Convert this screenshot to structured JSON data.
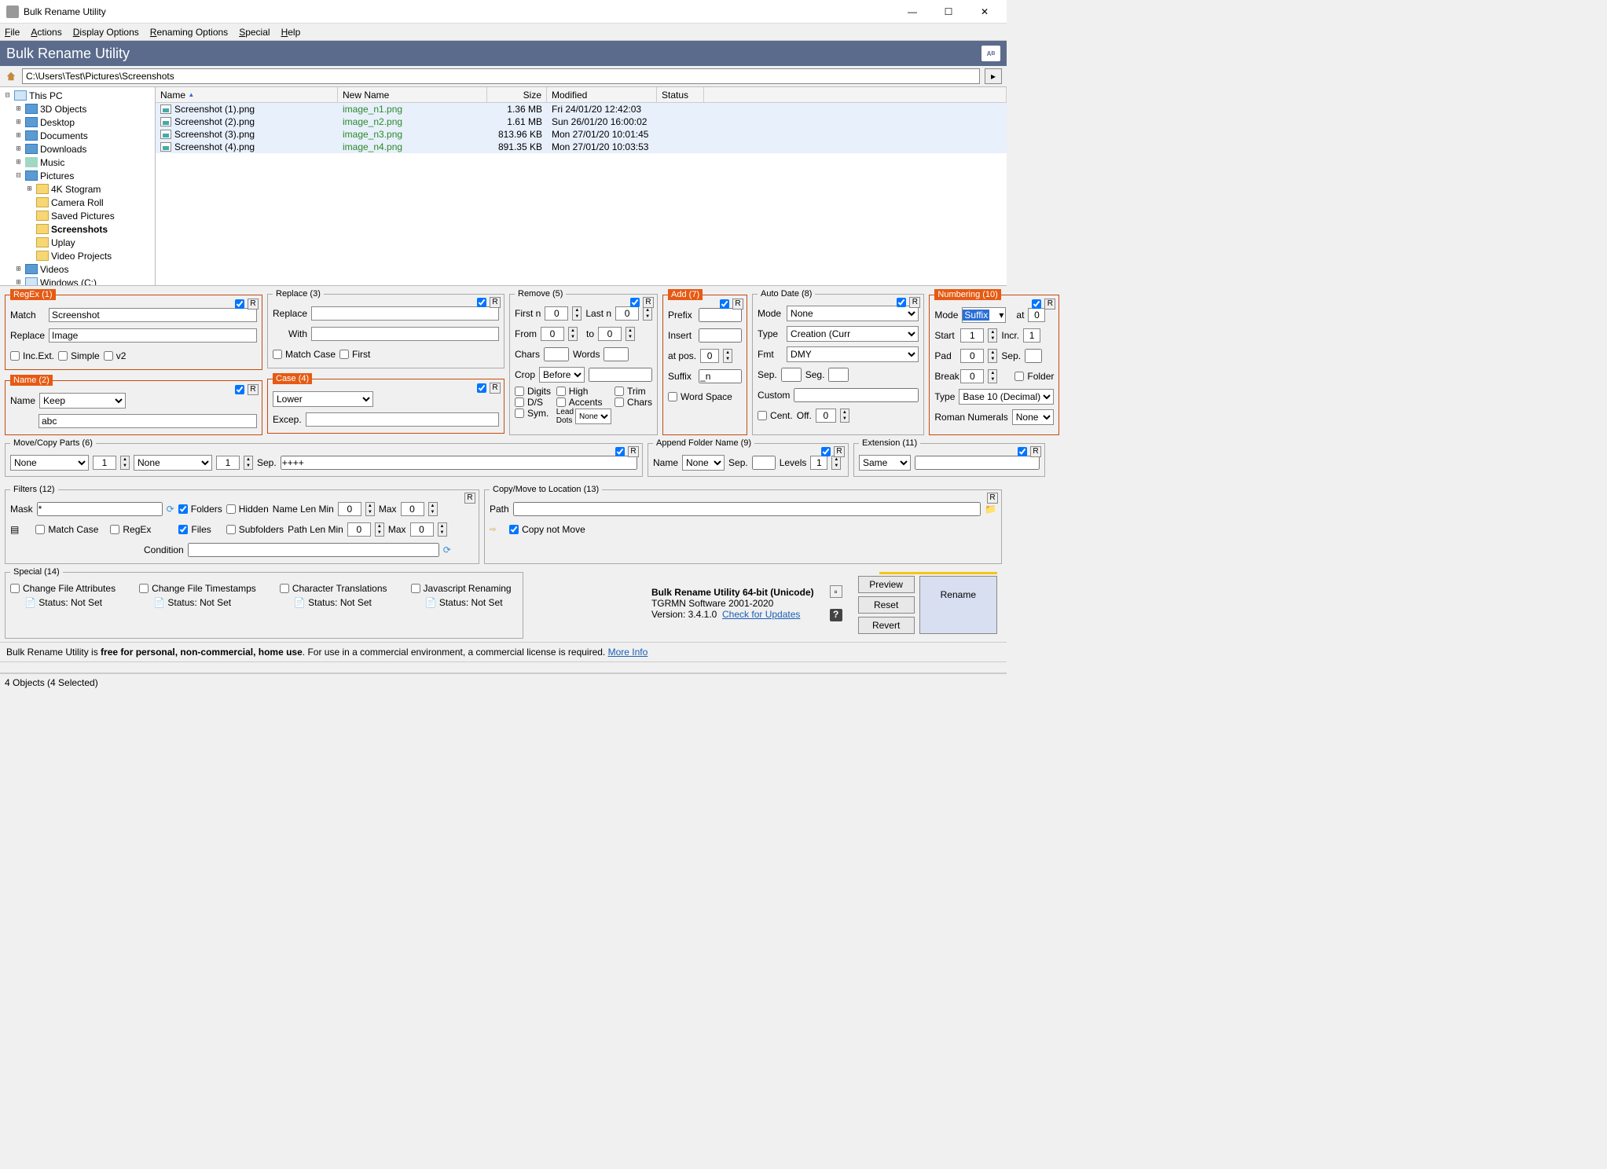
{
  "window": {
    "title": "Bulk Rename Utility"
  },
  "menu": [
    "File",
    "Actions",
    "Display Options",
    "Renaming Options",
    "Special",
    "Help"
  ],
  "banner": "Bulk Rename Utility",
  "path": "C:\\Users\\Test\\Pictures\\Screenshots",
  "tree": [
    {
      "indent": 0,
      "exp": "⊟",
      "icon": "pc",
      "label": "This PC"
    },
    {
      "indent": 1,
      "exp": "⊞",
      "icon": "blue",
      "label": "3D Objects"
    },
    {
      "indent": 1,
      "exp": "⊞",
      "icon": "blue",
      "label": "Desktop"
    },
    {
      "indent": 1,
      "exp": "⊞",
      "icon": "blue",
      "label": "Documents"
    },
    {
      "indent": 1,
      "exp": "⊞",
      "icon": "blue",
      "label": "Downloads"
    },
    {
      "indent": 1,
      "exp": "⊞",
      "icon": "music",
      "label": "Music"
    },
    {
      "indent": 1,
      "exp": "⊟",
      "icon": "blue",
      "label": "Pictures"
    },
    {
      "indent": 2,
      "exp": "⊞",
      "icon": "folder",
      "label": "4K Stogram"
    },
    {
      "indent": 2,
      "exp": "",
      "icon": "folder",
      "label": "Camera Roll"
    },
    {
      "indent": 2,
      "exp": "",
      "icon": "folder",
      "label": "Saved Pictures"
    },
    {
      "indent": 2,
      "exp": "",
      "icon": "folder",
      "label": "Screenshots",
      "bold": true
    },
    {
      "indent": 2,
      "exp": "",
      "icon": "folder",
      "label": "Uplay"
    },
    {
      "indent": 2,
      "exp": "",
      "icon": "folder",
      "label": "Video Projects"
    },
    {
      "indent": 1,
      "exp": "⊞",
      "icon": "blue",
      "label": "Videos"
    },
    {
      "indent": 1,
      "exp": "⊞",
      "icon": "drive",
      "label": "Windows (C:)"
    }
  ],
  "list": {
    "headers": {
      "name": "Name",
      "newname": "New Name",
      "size": "Size",
      "mod": "Modified",
      "status": "Status"
    },
    "rows": [
      {
        "name": "Screenshot (1).png",
        "newname": "image_n1.png",
        "size": "1.36 MB",
        "mod": "Fri 24/01/20 12:42:03"
      },
      {
        "name": "Screenshot (2).png",
        "newname": "image_n2.png",
        "size": "1.61 MB",
        "mod": "Sun 26/01/20 16:00:02"
      },
      {
        "name": "Screenshot (3).png",
        "newname": "image_n3.png",
        "size": "813.96 KB",
        "mod": "Mon 27/01/20 10:01:45"
      },
      {
        "name": "Screenshot (4).png",
        "newname": "image_n4.png",
        "size": "891.35 KB",
        "mod": "Mon 27/01/20 10:03:53"
      }
    ]
  },
  "regex": {
    "title": "RegEx (1)",
    "match_lbl": "Match",
    "match": "Screenshot",
    "replace_lbl": "Replace",
    "replace": "Image",
    "incext": "Inc.Ext.",
    "simple": "Simple",
    "v2": "v2"
  },
  "name": {
    "title": "Name (2)",
    "name_lbl": "Name",
    "mode": "Keep",
    "value": "abc"
  },
  "replace": {
    "title": "Replace (3)",
    "replace_lbl": "Replace",
    "with_lbl": "With",
    "matchcase": "Match Case",
    "first": "First"
  },
  "casep": {
    "title": "Case (4)",
    "mode": "Lower",
    "excep_lbl": "Excep."
  },
  "remove": {
    "title": "Remove (5)",
    "firstn": "First n",
    "lastn": "Last n",
    "from": "From",
    "to": "to",
    "chars": "Chars",
    "words": "Words",
    "crop": "Crop",
    "crop_mode": "Before",
    "digits": "Digits",
    "high": "High",
    "ds": "D/S",
    "accents": "Accents",
    "sym": "Sym.",
    "leaddots": "Lead Dots",
    "leaddots_mode": "None",
    "trim": "Trim",
    "chars2": "Chars",
    "v0": "0"
  },
  "add": {
    "title": "Add (7)",
    "prefix": "Prefix",
    "insert": "Insert",
    "atpos": "at pos.",
    "suffix": "Suffix",
    "suffix_val": "_n",
    "wordspace": "Word Space",
    "v0": "0"
  },
  "autodate": {
    "title": "Auto Date (8)",
    "mode_lbl": "Mode",
    "mode": "None",
    "type_lbl": "Type",
    "type": "Creation (Curr",
    "fmt_lbl": "Fmt",
    "fmt": "DMY",
    "sep": "Sep.",
    "seg": "Seg.",
    "custom": "Custom",
    "cent": "Cent.",
    "off": "Off.",
    "v0": "0"
  },
  "numbering": {
    "title": "Numbering (10)",
    "mode_lbl": "Mode",
    "mode": "Suffix",
    "at": "at",
    "at_v": "0",
    "start": "Start",
    "start_v": "1",
    "incr": "Incr.",
    "incr_v": "1",
    "pad": "Pad",
    "pad_v": "0",
    "sep": "Sep.",
    "break": "Break",
    "break_v": "0",
    "folder": "Folder",
    "type_lbl": "Type",
    "type": "Base 10 (Decimal)",
    "roman_lbl": "Roman Numerals",
    "roman": "None"
  },
  "movecopy": {
    "title": "Move/Copy Parts (6)",
    "none": "None",
    "v1": "1",
    "sep": "Sep.",
    "sepval": "++++"
  },
  "appendfolder": {
    "title": "Append Folder Name (9)",
    "name": "Name",
    "mode": "None",
    "sep": "Sep.",
    "levels": "Levels",
    "levels_v": "1"
  },
  "extension": {
    "title": "Extension (11)",
    "mode": "Same"
  },
  "filters": {
    "title": "Filters (12)",
    "mask": "Mask",
    "mask_v": "*",
    "folders": "Folders",
    "hidden": "Hidden",
    "files": "Files",
    "subfolders": "Subfolders",
    "namelenmin": "Name Len Min",
    "pathlenmin": "Path Len Min",
    "max": "Max",
    "matchcase": "Match Case",
    "regex": "RegEx",
    "condition": "Condition",
    "v0": "0"
  },
  "copymove": {
    "title": "Copy/Move to Location (13)",
    "path": "Path",
    "copynotmove": "Copy not Move"
  },
  "special": {
    "title": "Special (14)",
    "cfa": "Change File Attributes",
    "cft": "Change File Timestamps",
    "ct": "Character Translations",
    "jr": "Javascript Renaming",
    "status": "Status:",
    "notset": "Not Set"
  },
  "about": {
    "name": "Bulk Rename Utility 64-bit (Unicode)",
    "company": "TGRMN Software 2001-2020",
    "ver_lbl": "Version:",
    "ver": "3.4.1.0",
    "check": "Check for Updates"
  },
  "actions": {
    "preview": "Preview",
    "reset": "Reset",
    "revert": "Revert",
    "rename": "Rename"
  },
  "license": {
    "pre": "Bulk Rename Utility is ",
    "bold": "free for personal, non-commercial, home use",
    "post": ". For use in a commercial environment, a commercial license is required. ",
    "more": "More Info"
  },
  "status": "4 Objects (4 Selected)",
  "R": "R"
}
